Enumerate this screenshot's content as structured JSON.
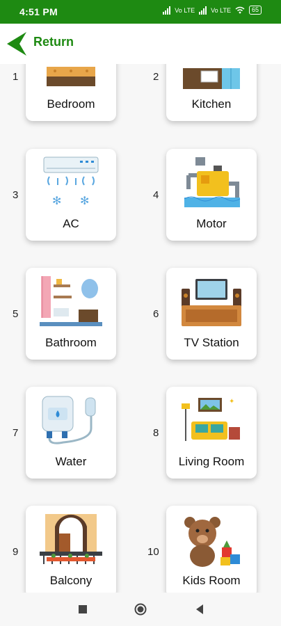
{
  "status": {
    "time": "4:51 PM",
    "net1": "Vo LTE",
    "net2": "Vo LTE",
    "battery": "65"
  },
  "header": {
    "return_label": "Return"
  },
  "rooms": [
    {
      "number": "1",
      "label": "Bedroom",
      "icon": "bedroom-icon"
    },
    {
      "number": "2",
      "label": "Kitchen",
      "icon": "kitchen-icon"
    },
    {
      "number": "3",
      "label": "AC",
      "icon": "ac-icon"
    },
    {
      "number": "4",
      "label": "Motor",
      "icon": "motor-icon"
    },
    {
      "number": "5",
      "label": "Bathroom",
      "icon": "bathroom-icon"
    },
    {
      "number": "6",
      "label": "TV Station",
      "icon": "tv-station-icon"
    },
    {
      "number": "7",
      "label": "Water",
      "icon": "water-heater-icon"
    },
    {
      "number": "8",
      "label": "Living Room",
      "icon": "living-room-icon"
    },
    {
      "number": "9",
      "label": "Balcony",
      "icon": "balcony-icon"
    },
    {
      "number": "10",
      "label": "Kids Room",
      "icon": "kids-room-icon"
    }
  ],
  "colors": {
    "brand": "#1e8a12",
    "card": "#ffffff",
    "background": "#f7f7f7"
  }
}
